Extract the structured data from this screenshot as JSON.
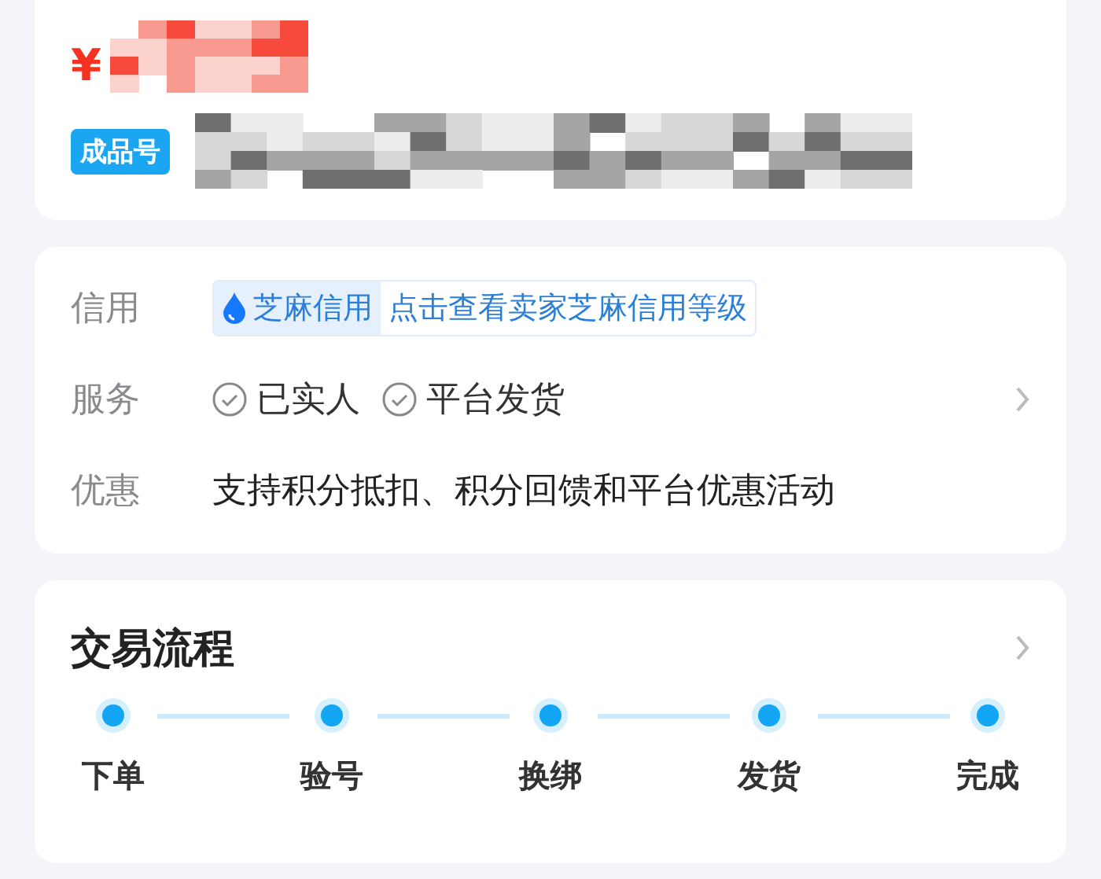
{
  "price": {
    "currency": "¥"
  },
  "product": {
    "badge": "成品号"
  },
  "info": {
    "rows": [
      {
        "kind": "credit",
        "label": "信用",
        "tag": "芝麻信用",
        "link": "点击查看卖家芝麻信用等级"
      },
      {
        "kind": "services",
        "label": "服务",
        "items": [
          "已实人",
          "平台发货"
        ]
      },
      {
        "kind": "text",
        "label": "优惠",
        "text": "支持积分抵扣、积分回馈和平台优惠活动"
      }
    ]
  },
  "process": {
    "title": "交易流程",
    "steps": [
      "下单",
      "验号",
      "换绑",
      "发货",
      "完成"
    ]
  }
}
